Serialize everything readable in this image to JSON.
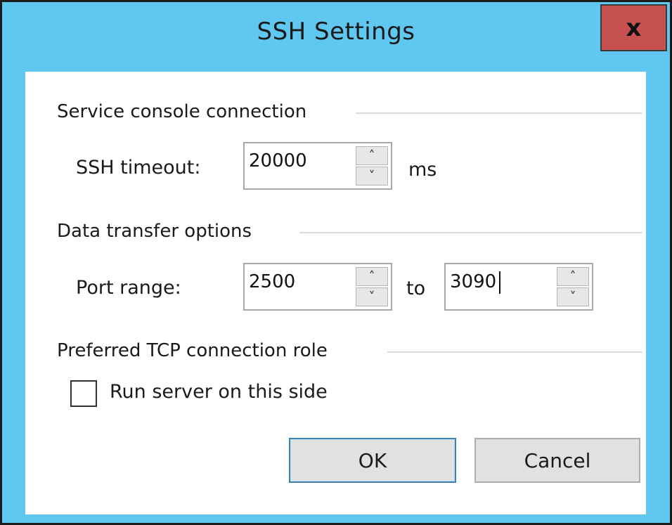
{
  "window": {
    "title": "SSH Settings",
    "close_label": "x"
  },
  "groups": {
    "service_console": {
      "title": "Service console connection",
      "ssh_timeout_label": "SSH timeout:",
      "ssh_timeout_value": "20000",
      "ssh_timeout_unit": "ms"
    },
    "data_transfer": {
      "title": "Data transfer options",
      "port_range_label": "Port range:",
      "port_from": "2500",
      "port_to_label": "to",
      "port_to": "3090"
    },
    "tcp_role": {
      "title": "Preferred TCP connection role",
      "run_server_label": "Run server on this side",
      "run_server_checked": false
    }
  },
  "buttons": {
    "ok": "OK",
    "cancel": "Cancel"
  },
  "spin_icons": {
    "up": "˄",
    "down": "˅"
  }
}
